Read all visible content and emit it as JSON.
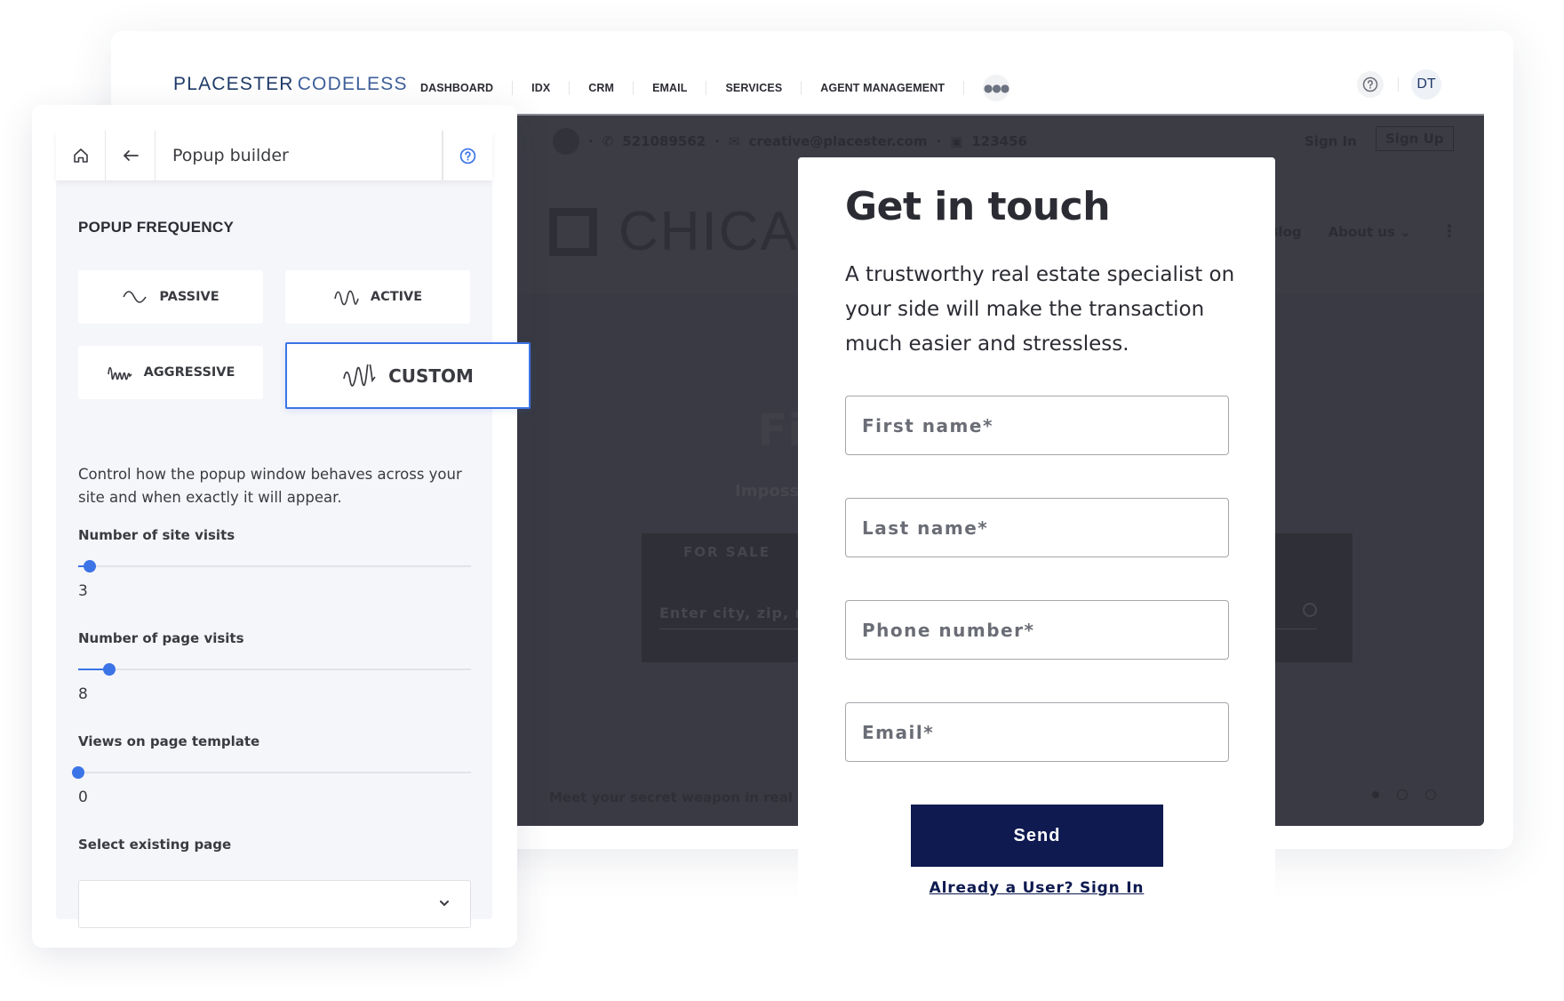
{
  "topnav": {
    "brand_primary": "PLACESTER",
    "brand_secondary": "CODELESS",
    "links": [
      "DASHBOARD",
      "IDX",
      "CRM",
      "EMAIL",
      "SERVICES",
      "AGENT MANAGEMENT"
    ],
    "more_icon": "ellipsis-icon",
    "help_icon": "question-circle-icon",
    "avatar_initials": "DT"
  },
  "site_preview": {
    "phone": "521089562",
    "email": "creative@placester.com",
    "license": "123456",
    "sign_in": "Sign In",
    "sign_up": "Sign Up",
    "logo_text": "CHICA",
    "menu": [
      "Blog",
      "About us"
    ],
    "about_chevron": "⌄",
    "hero_title": "Fi",
    "hero_subtitle": "Impossi",
    "search_tab": "FOR SALE",
    "search_placeholder": "Enter city, zip, neig",
    "tagline": "Meet your secret weapon in real estate",
    "carousel_active_index": 0,
    "carousel_count": 3
  },
  "popup": {
    "title": "Get in touch",
    "lead": "A trustworthy real estate specialist on your side will make the transaction much easier and stressless.",
    "fields": [
      {
        "placeholder": "First name*"
      },
      {
        "placeholder": "Last name*"
      },
      {
        "placeholder": "Phone number*"
      },
      {
        "placeholder": "Email*"
      }
    ],
    "submit_label": "Send",
    "signin_link": "Already a User? Sign In",
    "colors": {
      "button": "#0e1a50"
    }
  },
  "left_panel": {
    "header_title": "Popup builder",
    "section_title": "POPUP FREQUENCY",
    "frequency_options": [
      {
        "label": "PASSIVE",
        "icon": "wave-passive-icon",
        "selected": false
      },
      {
        "label": "ACTIVE",
        "icon": "wave-active-icon",
        "selected": false
      },
      {
        "label": "AGGRESSIVE",
        "icon": "wave-aggressive-icon",
        "selected": false
      },
      {
        "label": "CUSTOM",
        "icon": "wave-custom-icon",
        "selected": true
      }
    ],
    "description": "Control how the popup window behaves across your site and when exactly it will appear.",
    "sliders": [
      {
        "label": "Number of site visits",
        "value": "3",
        "fraction": 0.03
      },
      {
        "label": "Number of page visits",
        "value": "8",
        "fraction": 0.08
      },
      {
        "label": "Views on page template",
        "value": "0",
        "fraction": 0.0
      }
    ],
    "select_label": "Select existing page",
    "select_value": "",
    "accent_color": "#3b74e6"
  }
}
